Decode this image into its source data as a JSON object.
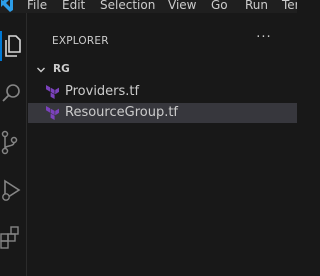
{
  "menubar": {
    "items": [
      "File",
      "Edit",
      "Selection",
      "View",
      "Go",
      "Run",
      "Ter"
    ]
  },
  "activity_bar": {
    "icons": [
      "explorer-icon",
      "search-icon",
      "source-control-icon",
      "run-debug-icon",
      "extensions-icon"
    ],
    "active": "explorer-icon"
  },
  "explorer": {
    "title": "EXPLORER",
    "more_label": "···",
    "folder": {
      "name": "RG",
      "expanded": true
    },
    "files": [
      {
        "name": "Providers.tf",
        "icon": "terraform-icon",
        "selected": false
      },
      {
        "name": "ResourceGroup.tf",
        "icon": "terraform-icon",
        "selected": true
      }
    ]
  },
  "colors": {
    "background": "#181818",
    "menubar": "#1f1f1f",
    "selection": "#37373d",
    "accent": "#0078d4",
    "terraform": "#7b42bc",
    "text": "#cccccc"
  }
}
